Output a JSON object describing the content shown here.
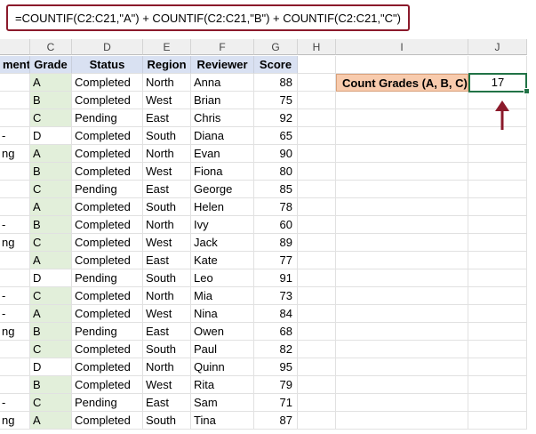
{
  "formula": "=COUNTIF(C2:C21,\"A\") + COUNTIF(C2:C21,\"B\") + COUNTIF(C2:C21,\"C\")",
  "column_headers": [
    "C",
    "D",
    "E",
    "F",
    "G",
    "H",
    "I",
    "J"
  ],
  "selected_column": "J",
  "table_headers": {
    "b": "ment",
    "c": "Grade",
    "d": "Status",
    "e": "Region",
    "f": "Reviewer",
    "g": "Score"
  },
  "rows": [
    {
      "b": "",
      "c": "A",
      "d": "Completed",
      "e": "North",
      "f": "Anna",
      "g": "88"
    },
    {
      "b": "",
      "c": "B",
      "d": "Completed",
      "e": "West",
      "f": "Brian",
      "g": "75"
    },
    {
      "b": "",
      "c": "C",
      "d": "Pending",
      "e": "East",
      "f": "Chris",
      "g": "92"
    },
    {
      "b": "-",
      "c": "D",
      "d": "Completed",
      "e": "South",
      "f": "Diana",
      "g": "65"
    },
    {
      "b": "ng",
      "c": "A",
      "d": "Completed",
      "e": "North",
      "f": "Evan",
      "g": "90"
    },
    {
      "b": "",
      "c": "B",
      "d": "Completed",
      "e": "West",
      "f": "Fiona",
      "g": "80"
    },
    {
      "b": "",
      "c": "C",
      "d": "Pending",
      "e": "East",
      "f": "George",
      "g": "85"
    },
    {
      "b": "",
      "c": "A",
      "d": "Completed",
      "e": "South",
      "f": "Helen",
      "g": "78"
    },
    {
      "b": "-",
      "c": "B",
      "d": "Completed",
      "e": "North",
      "f": "Ivy",
      "g": "60"
    },
    {
      "b": "ng",
      "c": "C",
      "d": "Completed",
      "e": "West",
      "f": "Jack",
      "g": "89"
    },
    {
      "b": "",
      "c": "A",
      "d": "Completed",
      "e": "East",
      "f": "Kate",
      "g": "77"
    },
    {
      "b": "",
      "c": "D",
      "d": "Pending",
      "e": "South",
      "f": "Leo",
      "g": "91"
    },
    {
      "b": "-",
      "c": "C",
      "d": "Completed",
      "e": "North",
      "f": "Mia",
      "g": "73"
    },
    {
      "b": "-",
      "c": "A",
      "d": "Completed",
      "e": "West",
      "f": "Nina",
      "g": "84"
    },
    {
      "b": "ng",
      "c": "B",
      "d": "Pending",
      "e": "East",
      "f": "Owen",
      "g": "68"
    },
    {
      "b": "",
      "c": "C",
      "d": "Completed",
      "e": "South",
      "f": "Paul",
      "g": "82"
    },
    {
      "b": "",
      "c": "D",
      "d": "Completed",
      "e": "North",
      "f": "Quinn",
      "g": "95"
    },
    {
      "b": "",
      "c": "B",
      "d": "Completed",
      "e": "West",
      "f": "Rita",
      "g": "79"
    },
    {
      "b": "-",
      "c": "C",
      "d": "Pending",
      "e": "East",
      "f": "Sam",
      "g": "71"
    },
    {
      "b": "ng",
      "c": "A",
      "d": "Completed",
      "e": "South",
      "f": "Tina",
      "g": "87"
    }
  ],
  "summary": {
    "label": "Count Grades (A, B, C)",
    "value": "17"
  },
  "colors": {
    "accent": "#217346",
    "formula_border": "#8b1a2b",
    "arrow": "#8b1a2b",
    "header_fill": "#d9e1f2",
    "grade_fill": "#e2efda",
    "label_fill": "#f8cbad"
  }
}
